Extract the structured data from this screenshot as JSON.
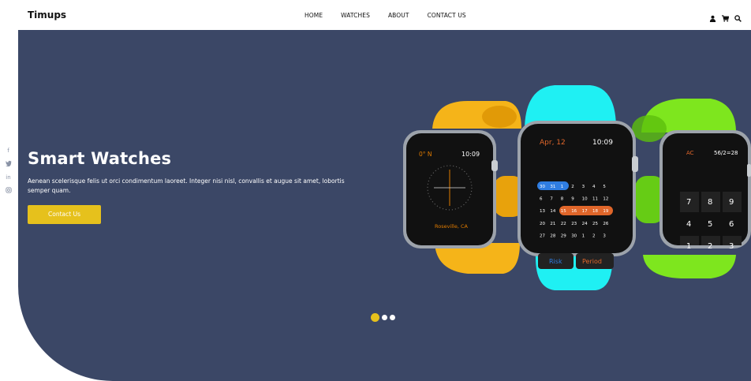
{
  "brand": {
    "name": "Timups"
  },
  "nav": {
    "items": [
      {
        "label": "HOME"
      },
      {
        "label": "WATCHES"
      },
      {
        "label": "ABOUT"
      },
      {
        "label": "CONTACT US"
      }
    ]
  },
  "header_icons": [
    "user-icon",
    "cart-icon",
    "search-icon"
  ],
  "social": {
    "items": [
      {
        "icon": "facebook-icon",
        "glyph": "f"
      },
      {
        "icon": "twitter-icon",
        "glyph": "t"
      },
      {
        "icon": "linkedin-icon",
        "glyph": "in"
      },
      {
        "icon": "instagram-icon",
        "glyph": "◎"
      }
    ]
  },
  "hero": {
    "title": "Smart Watches",
    "text": "Aenean scelerisque felis ut orci condimentum laoreet. Integer nisi nisl, convallis et augue sit amet, lobortis semper quam.",
    "button_label": "Contact Us"
  },
  "watch_left": {
    "temp": "0° N",
    "time": "10:09",
    "location": "Roseville, CA"
  },
  "watch_center": {
    "date": "Apr, 12",
    "time": "10:09",
    "calendar_rows": [
      [
        "30",
        "31",
        "1",
        "2",
        "3",
        "4",
        "5"
      ],
      [
        "6",
        "7",
        "8",
        "9",
        "10",
        "11",
        "12"
      ],
      [
        "13",
        "14",
        "15",
        "16",
        "17",
        "18",
        "19"
      ],
      [
        "20",
        "21",
        "22",
        "23",
        "24",
        "25",
        "26"
      ],
      [
        "27",
        "28",
        "29",
        "30",
        "1",
        "2",
        "3"
      ]
    ],
    "button_left": "Risk",
    "button_right": "Period"
  },
  "watch_right": {
    "ac": "AC",
    "expr": "56/2=28",
    "keys": [
      "7",
      "8",
      "9",
      "4",
      "5",
      "6",
      "1",
      "2",
      "3"
    ]
  },
  "colors": {
    "hero_bg": "#3b4766",
    "accent": "#e6c11c",
    "band_yellow": "#f5b419",
    "band_cyan": "#1ff0f3",
    "band_green": "#7ee61e"
  },
  "slider": {
    "count": 3,
    "active": 1
  }
}
